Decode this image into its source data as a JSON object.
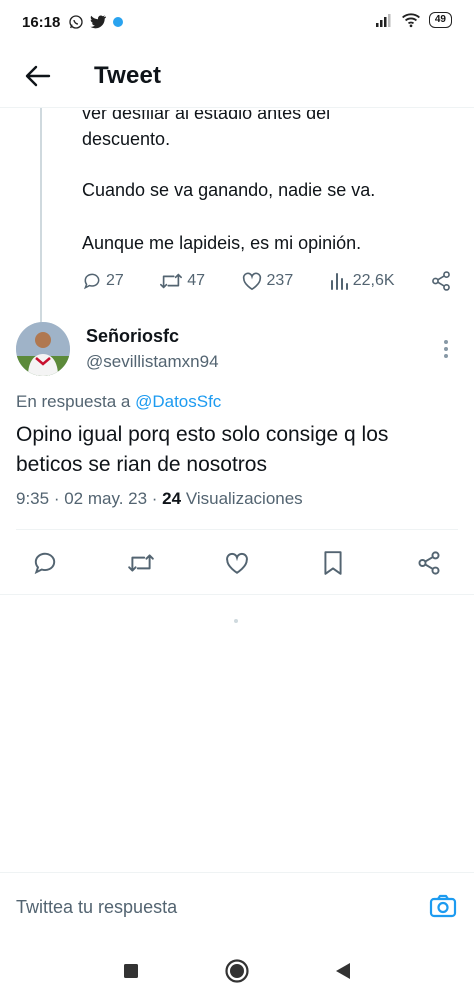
{
  "status": {
    "time": "16:18",
    "battery": "49"
  },
  "header": {
    "title": "Tweet"
  },
  "prev_tweet": {
    "lines": [
      "ver desfilar al estadio antes del",
      "descuento.",
      "Cuando se va ganando, nadie se va.",
      "Aunque me lapideis, es mi opinión."
    ],
    "replies": "27",
    "retweets": "47",
    "likes": "237",
    "views": "22,6K"
  },
  "tweet": {
    "name": "Señoriosfc",
    "handle": "@sevillistamxn94",
    "reply_prefix": "En respuesta a ",
    "reply_to": "@DatosSfc",
    "text": "Opino igual porq esto solo consige q los beticos se rian de nosotros",
    "time": "9:35",
    "date": "02 may. 23",
    "views_count": "24",
    "views_label": "Visualizaciones"
  },
  "compose": {
    "placeholder": "Twittea tu respuesta"
  },
  "colors": {
    "accent": "#1d9bf0",
    "muted": "#536471",
    "text": "#0f1419"
  }
}
